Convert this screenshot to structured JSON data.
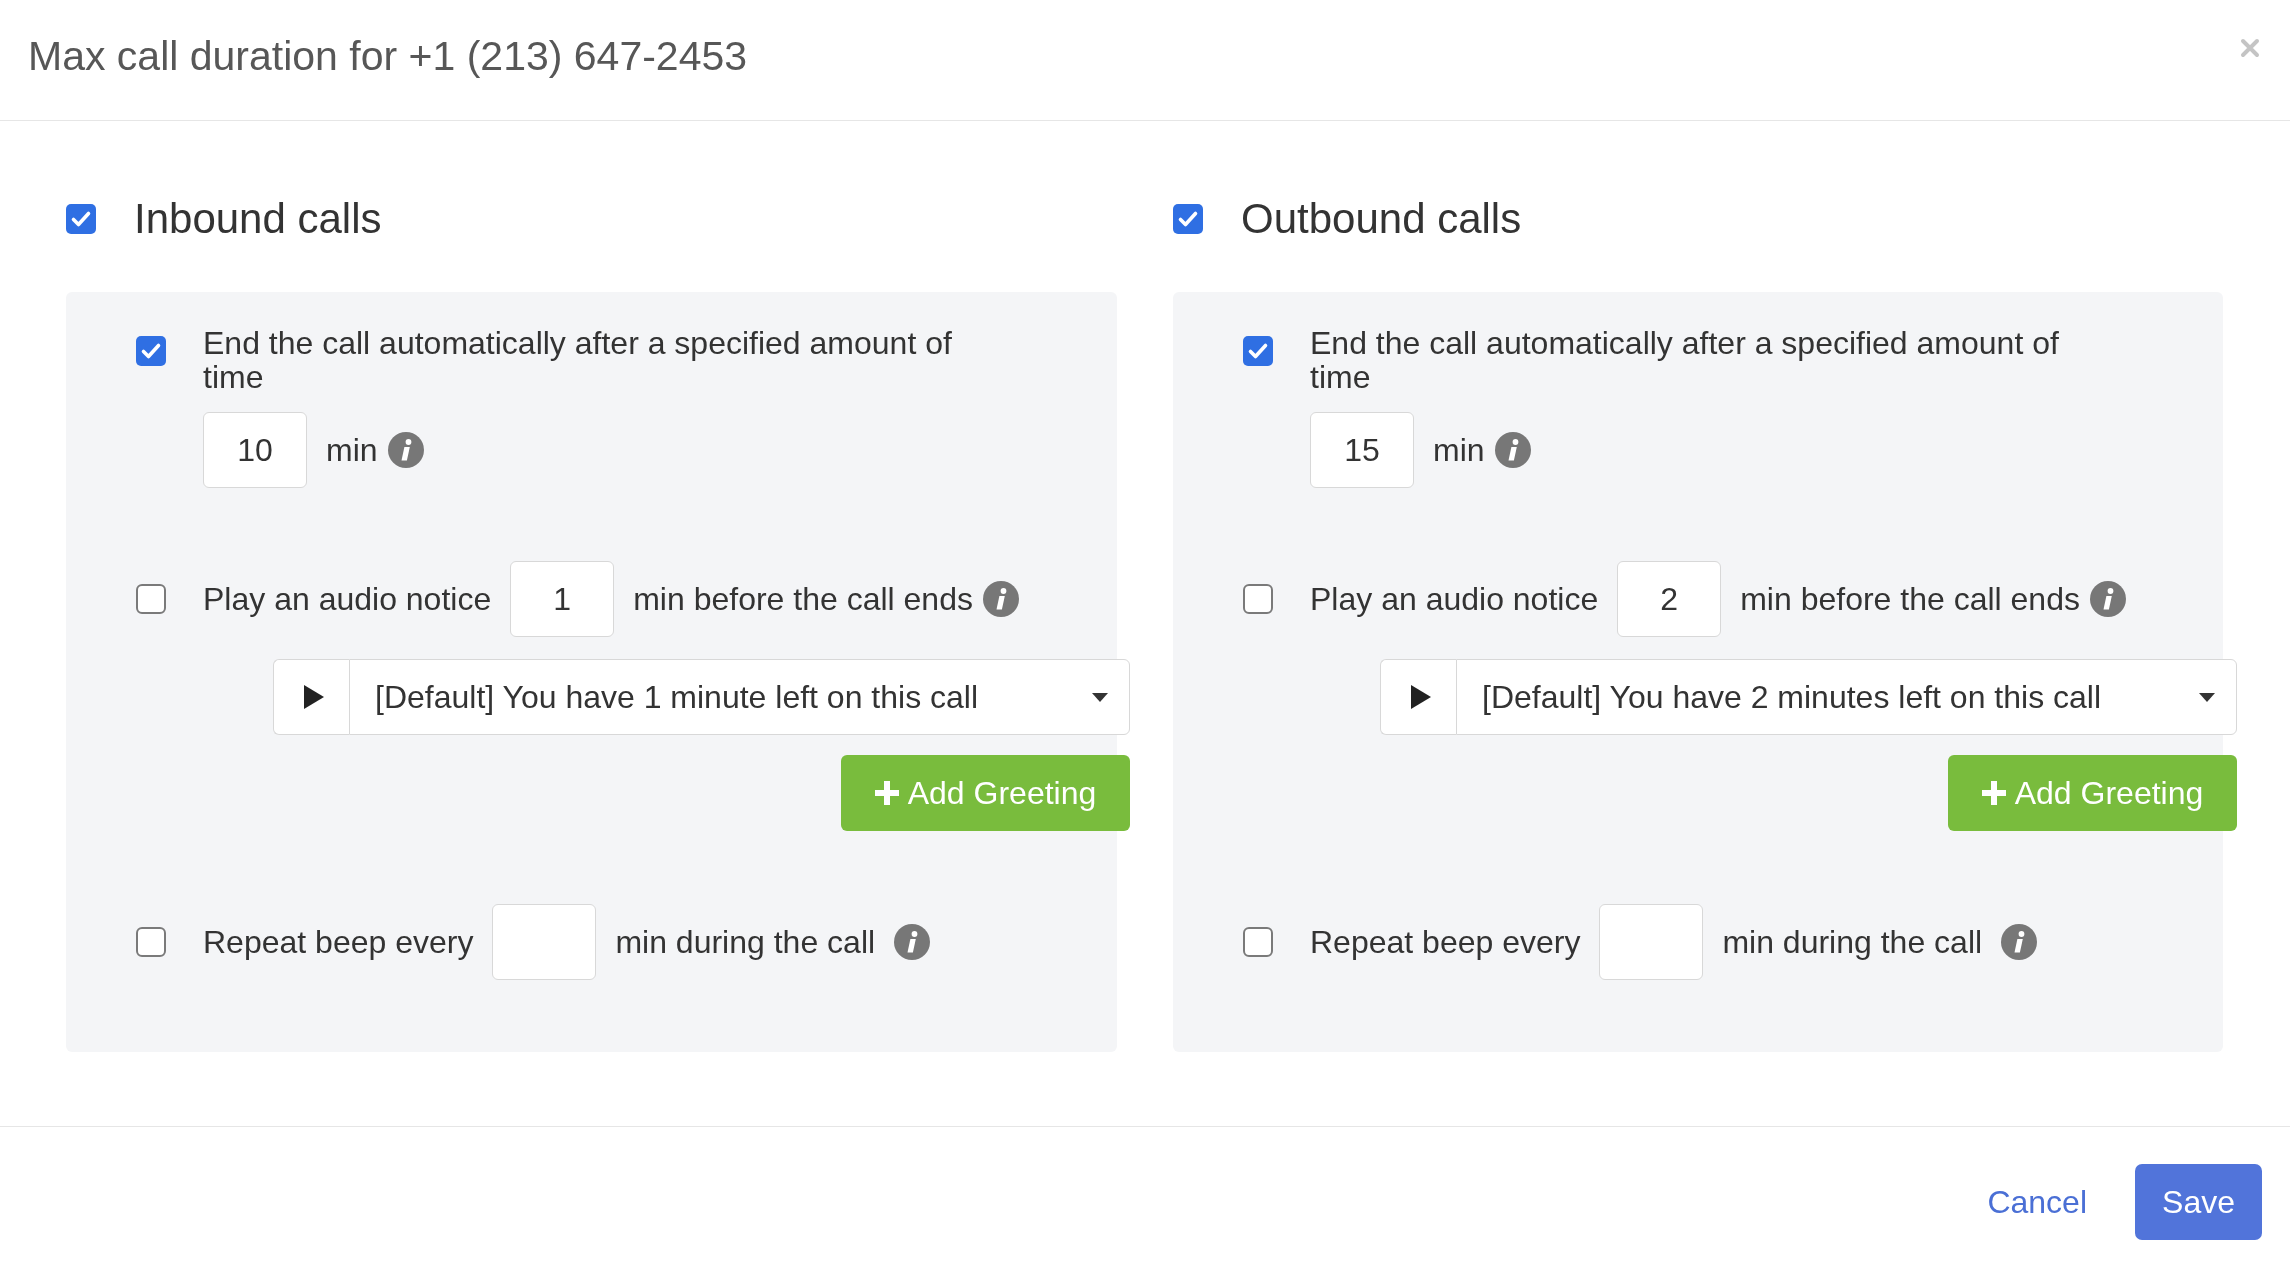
{
  "dialog": {
    "title": "Max call duration for +1 (213) 647-2453"
  },
  "sections": [
    {
      "label": "Inbound calls",
      "checked": true,
      "options": [
        {
          "kind": "limit",
          "checked": true,
          "label": "End the call automatically after a specified amount of time",
          "value": "10",
          "unit": "min"
        },
        {
          "kind": "notice",
          "checked": false,
          "label_before": "Play an audio notice",
          "value": "1",
          "label_after": "min before the call ends",
          "greeting": "[Default] You have 1 minute left on this call",
          "add_button": "Add Greeting"
        },
        {
          "kind": "beep",
          "checked": false,
          "label_before": "Repeat beep every",
          "label_after": "min during the call"
        }
      ]
    },
    {
      "label": "Outbound calls",
      "checked": true,
      "options": [
        {
          "kind": "limit",
          "checked": true,
          "label": "End the call automatically after a specified amount of time",
          "value": "15",
          "unit": "min"
        },
        {
          "kind": "notice",
          "checked": false,
          "label_before": "Play an audio notice",
          "value": "2",
          "label_after": "min before the call ends",
          "greeting": "[Default] You have 2 minutes left on this call",
          "add_button": "Add Greeting"
        },
        {
          "kind": "beep",
          "checked": false,
          "label_before": "Repeat beep every",
          "label_after": "min during the call"
        }
      ]
    }
  ],
  "footer": {
    "buttons": [
      {
        "kind": "link",
        "label": "Cancel"
      },
      {
        "kind": "primary",
        "label": "Save"
      }
    ]
  }
}
